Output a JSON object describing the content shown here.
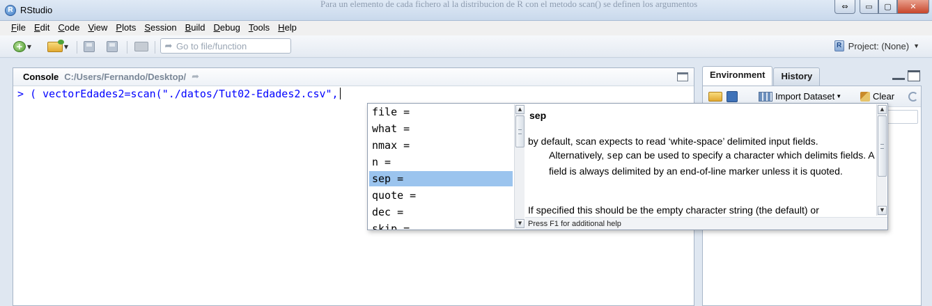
{
  "window": {
    "title": "RStudio",
    "background_text": "Para un elemento de cada fichero al la distribucion de R con el metodo scan() se definen los argumentos",
    "buttons": {
      "restore": "⇔",
      "minimize": "▭",
      "maximize": "▢",
      "close": "✕"
    }
  },
  "menu": [
    {
      "key": "F",
      "rest": "ile"
    },
    {
      "key": "E",
      "rest": "dit"
    },
    {
      "key": "C",
      "rest": "ode"
    },
    {
      "key": "V",
      "rest": "iew"
    },
    {
      "key": "P",
      "rest": "lots"
    },
    {
      "key": "S",
      "rest": "ession"
    },
    {
      "key": "B",
      "rest": "uild"
    },
    {
      "key": "D",
      "rest": "ebug"
    },
    {
      "key": "T",
      "rest": "ools"
    },
    {
      "key": "H",
      "rest": "elp"
    }
  ],
  "toolbar": {
    "goto_placeholder": "Go to file/function",
    "project_label": "Project: (None)",
    "icons": [
      "new-file-icon",
      "open-folder-icon",
      "save-icon",
      "save-all-icon",
      "print-icon"
    ]
  },
  "console": {
    "label": "Console",
    "path": "C:/Users/Fernando/Desktop/",
    "prompt": "> ",
    "input": "( vectorEdades2=scan(\"./datos/Tut02-Edades2.csv\","
  },
  "right_pane": {
    "tabs": [
      "Environment",
      "History"
    ],
    "active_tab": "Environment",
    "import_label": "Import Dataset",
    "clear_label": "Clear"
  },
  "autocomplete": {
    "items": [
      "file =",
      "what =",
      "nmax =",
      "n =",
      "sep =",
      "quote =",
      "dec =",
      "skip ="
    ],
    "selected_index": 4,
    "help": {
      "name": "sep",
      "p1_line1": "by default, scan expects to read ‘white-space’ delimited input fields.",
      "p1_line2_pre": "Alternatively, ",
      "p1_code": "sep",
      "p1_line2_post": " can be used to specify a character which delimits fields. A field is always delimited by an end-of-line marker unless it is quoted.",
      "p2": "If specified this should be the empty character string (the default) or",
      "footer": "Press F1 for additional help"
    }
  },
  "colors": {
    "selection": "#9bc4ee",
    "console_input": "#0000ff"
  }
}
